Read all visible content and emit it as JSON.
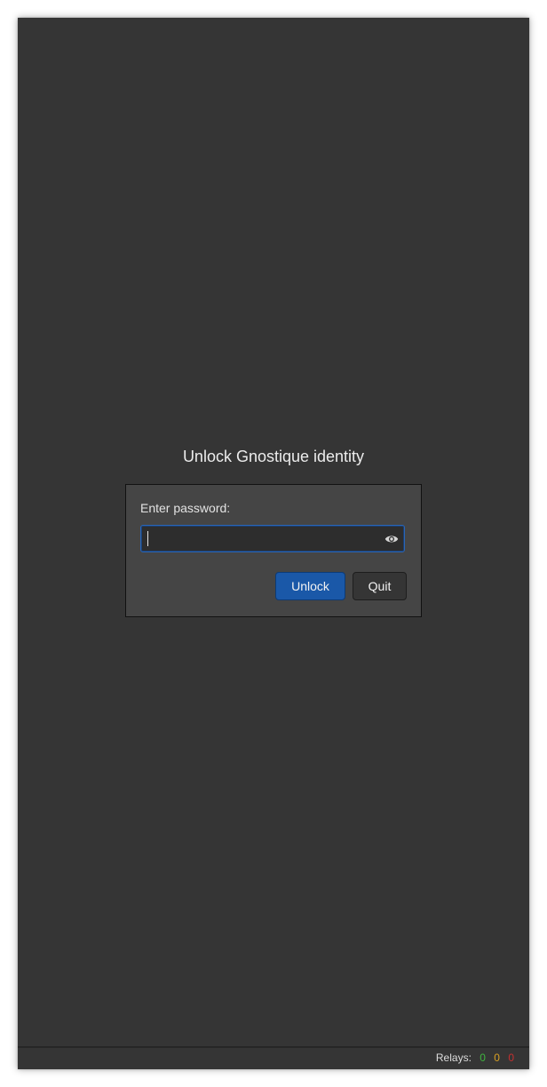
{
  "dialog": {
    "title": "Unlock Gnostique identity",
    "password_label": "Enter password:",
    "password_value": "",
    "password_placeholder": "",
    "reveal_icon": "eye-icon",
    "unlock_label": "Unlock",
    "quit_label": "Quit"
  },
  "statusbar": {
    "relays_label": "Relays:",
    "connected": "0",
    "connecting": "0",
    "disconnected": "0"
  },
  "colors": {
    "background": "#353535",
    "panel": "#454545",
    "accent": "#1a58a8",
    "status_green": "#3fb43f",
    "status_orange": "#d8a023",
    "status_red": "#c43030"
  }
}
